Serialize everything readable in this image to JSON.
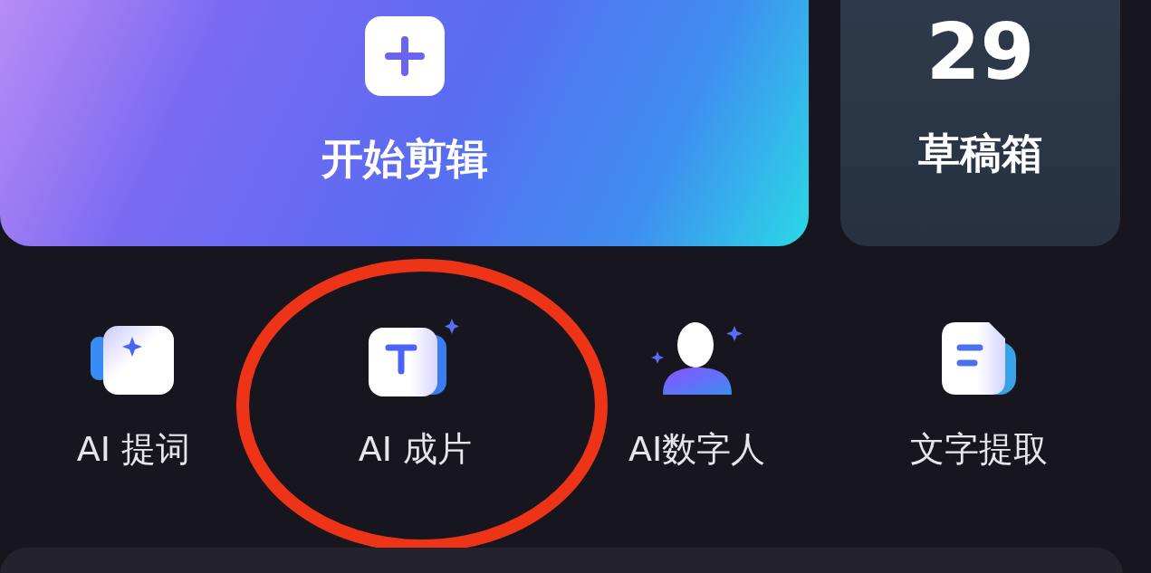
{
  "start_card": {
    "label": "开始剪辑"
  },
  "drafts_card": {
    "count": "29",
    "label": "草稿箱"
  },
  "tools": [
    {
      "label": "AI 提词",
      "highlighted": false
    },
    {
      "label": "AI 成片",
      "highlighted": true
    },
    {
      "label": "AI数字人",
      "highlighted": false
    },
    {
      "label": "文字提取",
      "highlighted": false
    }
  ]
}
